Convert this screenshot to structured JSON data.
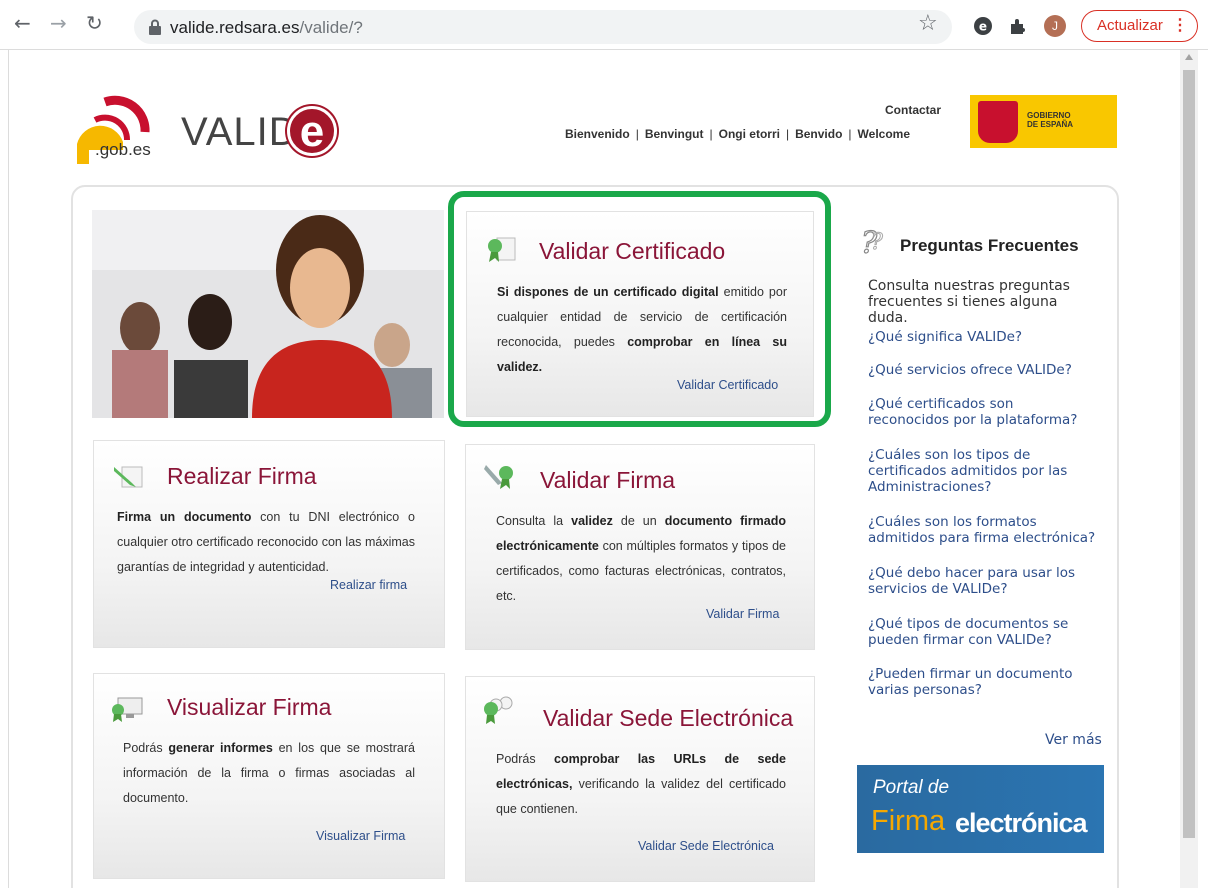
{
  "browser": {
    "url_host": "valide.redsara.es",
    "url_path": "/valide/?",
    "avatar_initial": "J",
    "update_label": "Actualizar"
  },
  "header": {
    "gob_text": ".gob.es",
    "logo_text": "VALID",
    "logo_e": "e",
    "contact": "Contactar",
    "languages": [
      "Bienvenido",
      "Benvingut",
      "Ongi etorri",
      "Benvido",
      "Welcome"
    ],
    "gov_line1": "GOBIERNO",
    "gov_line2": "DE ESPAÑA"
  },
  "cards": {
    "validar_certificado": {
      "title": "Validar Certificado",
      "b1": "Si dispones de un certificado digital",
      "t1": " emitido por cualquier entidad de servicio de certificación reconocida, puedes ",
      "b2": "comprobar en línea su validez.",
      "link": "Validar Certificado"
    },
    "realizar_firma": {
      "title": "Realizar Firma",
      "b1": "Firma un documento",
      "t1": " con tu DNI electrónico o cualquier otro certificado reconocido con las máximas garantías de integridad y autenticidad.",
      "link": "Realizar firma"
    },
    "validar_firma": {
      "title": "Validar Firma",
      "t0": "Consulta la ",
      "b1": "validez",
      "t1": " de un ",
      "b2": "documento firmado electrónicamente",
      "t2": " con múltiples formatos y tipos de certificados, como facturas electrónicas, contratos, etc.",
      "link": "Validar Firma"
    },
    "visualizar_firma": {
      "title": "Visualizar Firma",
      "t0": "Podrás ",
      "b1": "generar informes",
      "t1": " en los que se mostrará información de la firma o firmas asociadas al documento.",
      "link": "Visualizar Firma"
    },
    "validar_sede": {
      "title": "Validar Sede Electrónica",
      "t0": "Podrás ",
      "b1": "comprobar las URLs de sede electrónicas,",
      "t1": " verificando la validez del certificado que contienen.",
      "link": "Validar Sede Electrónica"
    }
  },
  "faq": {
    "title": "Preguntas Frecuentes",
    "intro": "Consulta nuestras preguntas frecuentes si tienes alguna duda.",
    "questions": [
      "¿Qué significa VALIDe?",
      "¿Qué servicios ofrece VALIDe?",
      "¿Qué certificados son reconocidos por la plataforma?",
      "¿Cuáles son los tipos de certificados admitidos por las Administraciones?",
      "¿Cuáles son los formatos admitidos para firma electrónica?",
      "¿Qué debo hacer para usar los servicios de VALIDe?",
      "¿Qué tipos de documentos se pueden firmar con VALIDe?",
      "¿Pueden firmar un documento varias personas?"
    ],
    "more": "Ver más"
  },
  "portal": {
    "line1": "Portal de",
    "line2a": "Firma",
    "line2b": "electrónica"
  }
}
